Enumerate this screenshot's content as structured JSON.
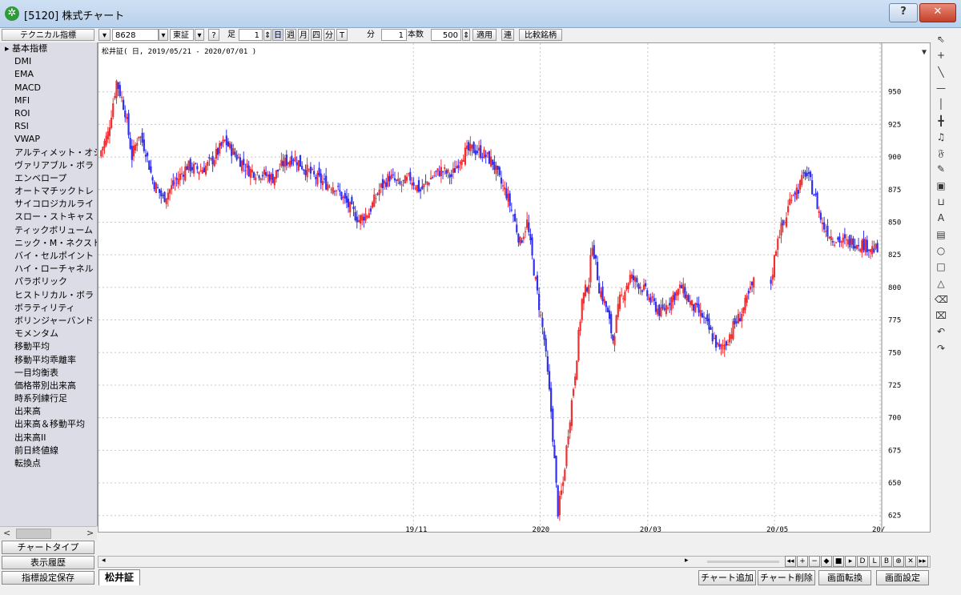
{
  "window": {
    "title": "[5120] 株式チャート",
    "help_label": "?",
    "close_label": "✕"
  },
  "toolbar": {
    "indicator_menu": "テクニカル指標",
    "code_value": "8628",
    "market_value": "東証",
    "question": "?",
    "ashi_label": "足",
    "period_value": "1",
    "day": "日",
    "week": "週",
    "month": "月",
    "quarter": "四",
    "minute": "分",
    "tick": "T",
    "fun_label": "分",
    "minute_value": "1",
    "count_label": "本数",
    "count_value": "500",
    "apply": "適用",
    "ren": "連",
    "compare": "比較銘柄"
  },
  "sidebar": {
    "header": "基本指標",
    "items": [
      "DMI",
      "EMA",
      "MACD",
      "MFI",
      "ROI",
      "RSI",
      "VWAP",
      "アルティメット・オシ",
      "ヴァリアブル・ボラ",
      "エンベロープ",
      "オートマチックトレ",
      "サイコロジカルライ",
      "スロー・ストキャス",
      "ティックボリューム",
      "ニック・M・ネクスト",
      "バイ・セルポイント",
      "ハイ・ローチャネル",
      "パラボリック",
      "ヒストリカル・ボラ",
      "ボラティリティ",
      "ボリンジャーバンド",
      "モメンタム",
      "移動平均",
      "移動平均乖離率",
      "一目均衡表",
      "価格帯別出来高",
      "時系列練行足",
      "出来高",
      "出来高＆移動平均",
      "出来高II",
      "前日終値線",
      "転換点"
    ],
    "scroll_left": "<",
    "scroll_right": ">"
  },
  "side_buttons": {
    "chart_type": "チャートタイプ",
    "history": "表示履歴",
    "save_settings": "指標設定保存"
  },
  "chart_title": "松井証( 日, 2019/05/21 - 2020/07/01 )",
  "nav": {
    "right_arrow": "▸",
    "buttons": [
      "◂◂",
      "+",
      "−",
      "◆",
      "■",
      "▸",
      "D",
      "L",
      "B",
      "⊕",
      "✕",
      "▸▸"
    ]
  },
  "bottom": {
    "tab": "松井証",
    "add_chart": "チャート追加",
    "delete_chart": "チャート削除",
    "switch_screen": "画面転換",
    "screen_settings": "画面設定"
  },
  "right_tools": [
    {
      "icon": "cursor-icon",
      "glyph": "⇖"
    },
    {
      "icon": "crosshair-icon",
      "glyph": "+"
    },
    {
      "icon": "trendline-icon",
      "glyph": "╲"
    },
    {
      "icon": "hline-icon",
      "glyph": "—"
    },
    {
      "icon": "vline-icon",
      "glyph": "│"
    },
    {
      "icon": "cross-line-icon",
      "glyph": "╋"
    },
    {
      "icon": "bell-icon",
      "glyph": "♫"
    },
    {
      "icon": "fib-icon",
      "glyph": "𝔉"
    },
    {
      "icon": "pen-icon",
      "glyph": "✎"
    },
    {
      "icon": "fan-icon",
      "glyph": "▣"
    },
    {
      "icon": "magnet-icon",
      "glyph": "⊔"
    },
    {
      "icon": "text-icon",
      "glyph": "A"
    },
    {
      "icon": "rect-fill-icon",
      "glyph": "▤"
    },
    {
      "icon": "ellipse-icon",
      "glyph": "○"
    },
    {
      "icon": "rect-icon",
      "glyph": "□"
    },
    {
      "icon": "triangle-icon",
      "glyph": "△"
    },
    {
      "icon": "eraser-icon",
      "glyph": "⌫"
    },
    {
      "icon": "eraser-all-icon",
      "glyph": "⌧"
    },
    {
      "icon": "undo-icon",
      "glyph": "↶"
    },
    {
      "icon": "redo-icon",
      "glyph": "↷"
    }
  ],
  "chart_data": {
    "type": "candlestick",
    "title": "松井証( 日, 2019/05/21 - 2020/07/01 )",
    "ylim": [
      615,
      975
    ],
    "y_ticks": [
      950,
      925,
      900,
      875,
      850,
      825,
      800,
      775,
      750,
      725,
      700,
      675,
      650,
      625
    ],
    "x_ticks": [
      {
        "label": "19/11",
        "date": "2019-11-01"
      },
      {
        "label": "2020",
        "date": "2020-01-06"
      },
      {
        "label": "20/03",
        "date": "2020-03-02"
      },
      {
        "label": "20/05",
        "date": "2020-05-07"
      },
      {
        "label": "20/",
        "date": "2020-07-01"
      }
    ],
    "colors": {
      "up": "#f03030",
      "down": "#3030f0"
    },
    "grid": true,
    "price_path": [
      [
        0,
        905
      ],
      [
        4,
        918
      ],
      [
        9,
        958
      ],
      [
        12,
        945
      ],
      [
        14,
        935
      ],
      [
        18,
        900
      ],
      [
        22,
        918
      ],
      [
        26,
        905
      ],
      [
        30,
        882
      ],
      [
        36,
        868
      ],
      [
        44,
        882
      ],
      [
        50,
        893
      ],
      [
        58,
        890
      ],
      [
        64,
        896
      ],
      [
        72,
        912
      ],
      [
        78,
        902
      ],
      [
        86,
        890
      ],
      [
        92,
        888
      ],
      [
        100,
        884
      ],
      [
        106,
        895
      ],
      [
        112,
        900
      ],
      [
        118,
        892
      ],
      [
        124,
        885
      ],
      [
        130,
        880
      ],
      [
        136,
        878
      ],
      [
        142,
        866
      ],
      [
        150,
        852
      ],
      [
        156,
        858
      ],
      [
        162,
        875
      ],
      [
        168,
        885
      ],
      [
        174,
        878
      ],
      [
        180,
        884
      ],
      [
        186,
        874
      ],
      [
        192,
        884
      ],
      [
        198,
        890
      ],
      [
        204,
        885
      ],
      [
        210,
        902
      ],
      [
        216,
        906
      ],
      [
        222,
        903
      ],
      [
        228,
        896
      ],
      [
        232,
        882
      ],
      [
        236,
        872
      ],
      [
        240,
        855
      ],
      [
        244,
        834
      ],
      [
        248,
        850
      ],
      [
        254,
        795
      ],
      [
        258,
        760
      ],
      [
        262,
        705
      ],
      [
        266,
        628
      ],
      [
        269,
        650
      ],
      [
        272,
        690
      ],
      [
        276,
        735
      ],
      [
        280,
        790
      ],
      [
        284,
        805
      ],
      [
        286,
        835
      ],
      [
        290,
        800
      ],
      [
        294,
        785
      ],
      [
        298,
        760
      ],
      [
        302,
        790
      ],
      [
        308,
        808
      ],
      [
        314,
        802
      ],
      [
        320,
        790
      ],
      [
        326,
        780
      ],
      [
        332,
        792
      ],
      [
        338,
        800
      ],
      [
        344,
        786
      ],
      [
        350,
        778
      ],
      [
        356,
        762
      ],
      [
        360,
        752
      ],
      [
        364,
        758
      ],
      [
        368,
        770
      ],
      [
        372,
        778
      ],
      [
        376,
        790
      ],
      [
        380,
        804
      ],
      [
        390,
        804
      ],
      [
        394,
        840
      ],
      [
        398,
        850
      ],
      [
        402,
        872
      ],
      [
        406,
        876
      ],
      [
        410,
        888
      ],
      [
        413,
        880
      ],
      [
        416,
        868
      ],
      [
        420,
        848
      ],
      [
        426,
        838
      ],
      [
        434,
        834
      ],
      [
        440,
        835
      ],
      [
        446,
        832
      ],
      [
        452,
        828
      ]
    ],
    "gap_after_index": 380
  }
}
